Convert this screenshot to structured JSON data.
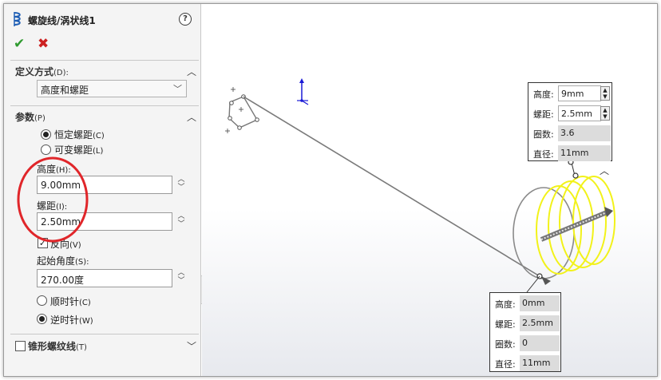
{
  "feature": {
    "title": "螺旋线/涡状线1"
  },
  "panel": {
    "definition": {
      "title": "定义方式",
      "shortcut": "(D):",
      "selected": "高度和螺距"
    },
    "parameters": {
      "title": "参数",
      "shortcut": "(P)",
      "pitch_modes": [
        {
          "label": "恒定螺距",
          "shortcut": "(C)",
          "selected": true
        },
        {
          "label": "可变螺距",
          "shortcut": "(L)",
          "selected": false
        }
      ],
      "height_label": "高度",
      "height_shortcut": "(H):",
      "height_value": "9.00mm",
      "pitch_label": "螺距",
      "pitch_shortcut": "(I):",
      "pitch_value": "2.50mm",
      "reverse_label": "反向",
      "reverse_shortcut": "(V)",
      "reverse_checked": true,
      "start_angle_label": "起始角度",
      "start_angle_shortcut": "(S):",
      "start_angle_value": "270.00度",
      "directions": [
        {
          "label": "顺时针",
          "shortcut": "(C)",
          "selected": false
        },
        {
          "label": "逆时针",
          "shortcut": "(W)",
          "selected": true
        }
      ]
    },
    "taper": {
      "label": "锥形螺纹线",
      "shortcut": "(T)",
      "checked": false
    }
  },
  "callout_top": {
    "rows": [
      {
        "key": "高度:",
        "value": "9mm"
      },
      {
        "key": "螺距:",
        "value": "2.5mm"
      },
      {
        "key": "圈数:",
        "value": "3.6"
      },
      {
        "key": "直径:",
        "value": "11mm"
      }
    ]
  },
  "callout_bottom": {
    "rows": [
      {
        "key": "高度:",
        "value": "0mm"
      },
      {
        "key": "螺距:",
        "value": "2.5mm"
      },
      {
        "key": "圈数:",
        "value": "0"
      },
      {
        "key": "直径:",
        "value": "11mm"
      }
    ]
  },
  "colors": {
    "helix_preview": "#f2f21a",
    "annotation_circle": "#e0262a",
    "ok_green": "#2f9a2f",
    "cancel_red": "#cc2020",
    "triad_blue": "#1a1ad6"
  },
  "icons": {
    "title": "helix-icon",
    "help": "help-icon",
    "ok": "check-icon",
    "cancel": "close-icon",
    "collapse": "chevron-up-icon",
    "expand": "chevron-down-icon"
  }
}
